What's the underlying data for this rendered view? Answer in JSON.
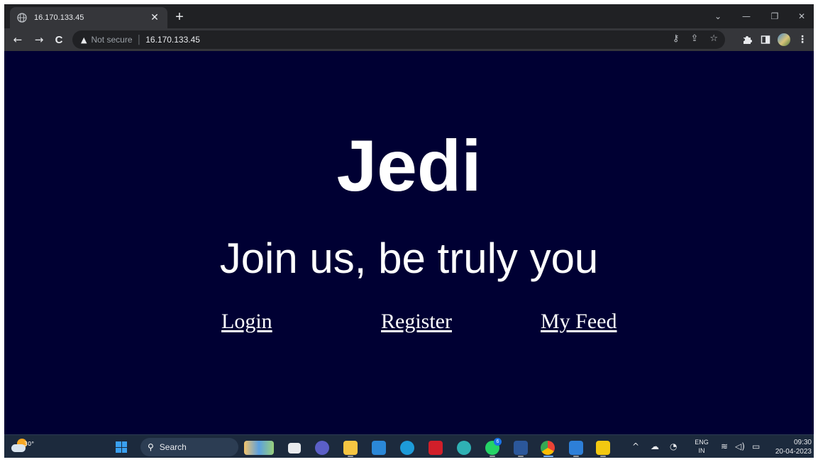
{
  "browser": {
    "tab": {
      "title": "16.170.133.45",
      "close_glyph": "✕"
    },
    "new_tab_glyph": "+",
    "window_controls": [
      "⌄",
      "—",
      "❐",
      "✕"
    ],
    "nav": {
      "back": "←",
      "forward": "→",
      "reload": "C"
    },
    "omnibox": {
      "security_label": "Not secure",
      "url": "16.170.133.45"
    },
    "omnibox_icons": [
      "key-icon",
      "share-icon",
      "star-icon"
    ],
    "extension_icons": [
      "puzzle-icon",
      "sidepanel-icon",
      "profile-avatar",
      "menu-icon"
    ]
  },
  "page": {
    "title": "Jedi",
    "tagline": "Join us, be truly you",
    "links": [
      "Login",
      "Register",
      "My Feed"
    ],
    "background_color": "#000033",
    "text_color": "#ffffff"
  },
  "taskbar": {
    "weather": {
      "temperature": "30°"
    },
    "search_label": "Search",
    "pinned_apps": [
      "widgets-icon",
      "task-view-icon",
      "teams-chat-icon",
      "file-explorer-icon",
      "store-icon",
      "edge-beta-icon",
      "mcafee-icon",
      "edge-icon",
      "whatsapp-icon",
      "word-icon",
      "chrome-icon",
      "photos-icon",
      "powerbi-icon"
    ],
    "whatsapp_badge": "6",
    "language": {
      "line1": "ENG",
      "line2": "IN"
    },
    "clock": {
      "time": "09:30",
      "date": "20-04-2023"
    }
  }
}
